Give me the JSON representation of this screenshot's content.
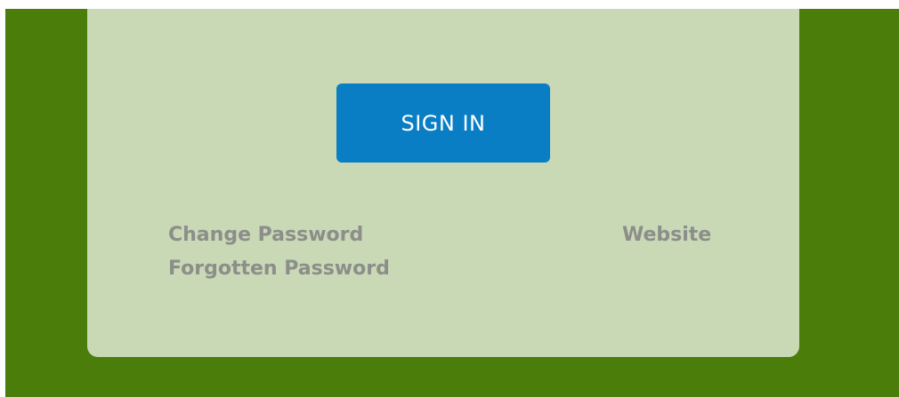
{
  "login": {
    "signin_label": "SIGN IN"
  },
  "links": {
    "change_password": "Change Password",
    "forgotten_password": "Forgotten Password",
    "website": "Website"
  },
  "colors": {
    "outer_background": "#4a7d0a",
    "card_background": "#c9d8b5",
    "button_background": "#0a7ec4",
    "button_text": "#ffffff",
    "link_text": "#8c8e8a"
  }
}
